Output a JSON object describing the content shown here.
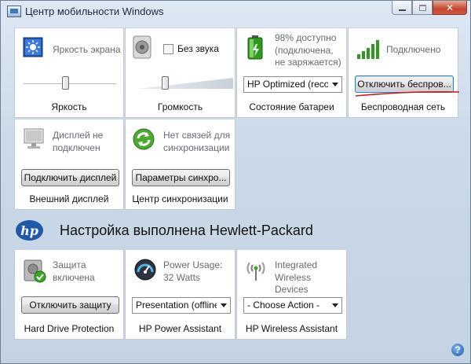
{
  "window": {
    "title": "Центр мобильности Windows",
    "caption_buttons": {
      "minimize": "—",
      "maximize": "□",
      "close": "✕"
    }
  },
  "tiles": {
    "brightness": {
      "text": "Яркость экрана",
      "label": "Яркость",
      "icon": "display-brightness-icon",
      "value_fraction": 0.45
    },
    "volume": {
      "mute_label": "Без звука",
      "mute_checked": false,
      "label": "Громкость",
      "icon": "speaker-icon",
      "value_fraction": 0.3
    },
    "battery": {
      "status_line1": "98% доступно",
      "status_line2": "(подключена,",
      "status_line3": "не заряжается)",
      "plan_value": "HP Optimized (reco",
      "label": "Состояние батареи",
      "icon": "battery-plugged-icon",
      "charge_percent": 98
    },
    "wireless": {
      "status": "Подключено",
      "button": "Отключить беспров...",
      "label": "Беспроводная сеть",
      "icon": "signal-bars-icon"
    },
    "display": {
      "line1": "Дисплей не",
      "line2": "подключен",
      "button": "Подключить дисплей",
      "label": "Внешний дисплей",
      "icon": "monitor-icon"
    },
    "sync": {
      "line1": "Нет связей для",
      "line2": "синхронизации",
      "button": "Параметры синхро...",
      "label": "Центр синхронизации",
      "icon": "sync-arrows-icon"
    }
  },
  "hp_section": {
    "logo": "hp",
    "title": "Настройка выполнена Hewlett-Packard"
  },
  "hp_tiles": {
    "drive": {
      "line1": "Защита",
      "line2": "включена",
      "button": "Отключить защиту",
      "label": "Hard Drive Protection",
      "icon": "hard-drive-check-icon"
    },
    "power": {
      "line1": "Power Usage:",
      "line2": "32 Watts",
      "dropdown": "Presentation (offline",
      "label": "HP Power Assistant",
      "icon": "power-gauge-icon"
    },
    "wireless_assistant": {
      "line1": "Integrated",
      "line2": "Wireless Devices",
      "dropdown": "- Choose Action -",
      "label": "HP Wireless Assistant",
      "icon": "antenna-icon"
    }
  },
  "help": {
    "glyph": "?"
  },
  "colors": {
    "accent": "#1e5aa8",
    "annotation_red": "#d11a1a",
    "signal_green": "#2f9a1f"
  }
}
